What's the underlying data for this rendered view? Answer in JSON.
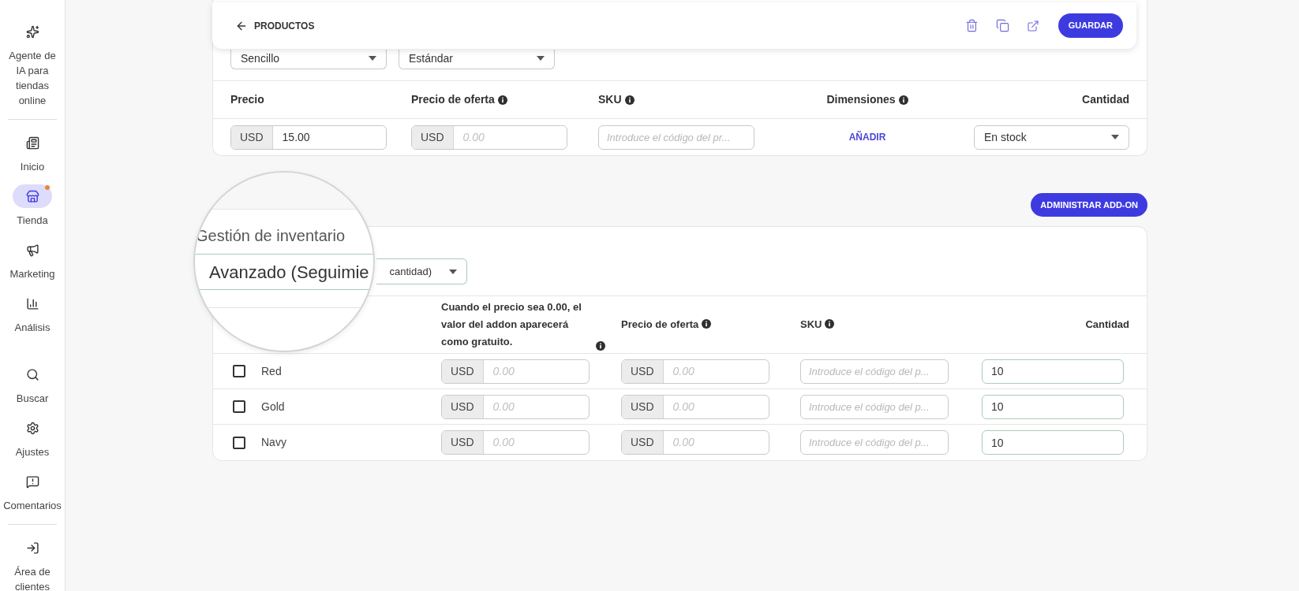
{
  "sidebar": {
    "items": [
      {
        "kind": "sparkles",
        "label": "Agente de IA para tiendas online",
        "selected": false,
        "notification": false
      },
      {
        "kind": "divider"
      },
      {
        "kind": "home",
        "label": "Inicio",
        "selected": false,
        "notification": false
      },
      {
        "kind": "store",
        "label": "Tienda",
        "selected": true,
        "notification": true
      },
      {
        "kind": "megaphone",
        "label": "Marketing",
        "selected": false,
        "notification": false
      },
      {
        "kind": "chart",
        "label": "Análisis",
        "selected": false,
        "notification": false
      },
      {
        "kind": "search",
        "label": "Buscar",
        "selected": false,
        "notification": false
      },
      {
        "kind": "settings",
        "label": "Ajustes",
        "selected": false,
        "notification": false
      },
      {
        "kind": "feedback",
        "label": "Comentarios",
        "selected": false,
        "notification": false
      },
      {
        "kind": "divider"
      },
      {
        "kind": "exit",
        "label": "Área de clientes",
        "selected": false,
        "notification": false
      }
    ]
  },
  "header": {
    "back_label": "PRODUCTOS",
    "save_label": "GUARDAR"
  },
  "product": {
    "selects": [
      "Sencillo",
      "Estándar"
    ],
    "columns": [
      {
        "label": "Precio",
        "info": false
      },
      {
        "label": "Precio de oferta",
        "info": true
      },
      {
        "label": "SKU",
        "info": true
      },
      {
        "label": "Dimensiones",
        "info": true
      },
      {
        "label": "Cantidad",
        "info": false
      }
    ],
    "price": {
      "currency": "USD",
      "value": "15.00"
    },
    "sale_price": {
      "currency": "USD",
      "placeholder": "0.00"
    },
    "sku_placeholder": "Introduce el código del pr...",
    "dimensions_link": "AÑADIR",
    "quantity": "En stock"
  },
  "addons": {
    "manage_button": "ADMINISTRAR ADD-ON",
    "magnifier": {
      "label": "Gestión de inventario",
      "value": "Avanzado (Seguimie"
    },
    "inventory_select_tail": "cantidad)",
    "columns": [
      {
        "label": "Cuando el precio sea 0.00, el valor del addon aparecerá como gratuito.",
        "info": true
      },
      {
        "label": "Precio de oferta",
        "info": true
      },
      {
        "label": "SKU",
        "info": true
      },
      {
        "label": "Cantidad",
        "info": false
      }
    ],
    "rows": [
      {
        "name": "Red",
        "checked": false,
        "price": {
          "currency": "USD",
          "placeholder": "0.00"
        },
        "sale_price": {
          "currency": "USD",
          "placeholder": "0.00"
        },
        "sku_placeholder": "Introduce el código del p...",
        "quantity": "10"
      },
      {
        "name": "Gold",
        "checked": false,
        "price": {
          "currency": "USD",
          "placeholder": "0.00"
        },
        "sale_price": {
          "currency": "USD",
          "placeholder": "0.00"
        },
        "sku_placeholder": "Introduce el código del p...",
        "quantity": "10"
      },
      {
        "name": "Navy",
        "checked": false,
        "price": {
          "currency": "USD",
          "placeholder": "0.00"
        },
        "sale_price": {
          "currency": "USD",
          "placeholder": "0.00"
        },
        "sku_placeholder": "Introduce el código del p...",
        "quantity": "10"
      }
    ]
  }
}
